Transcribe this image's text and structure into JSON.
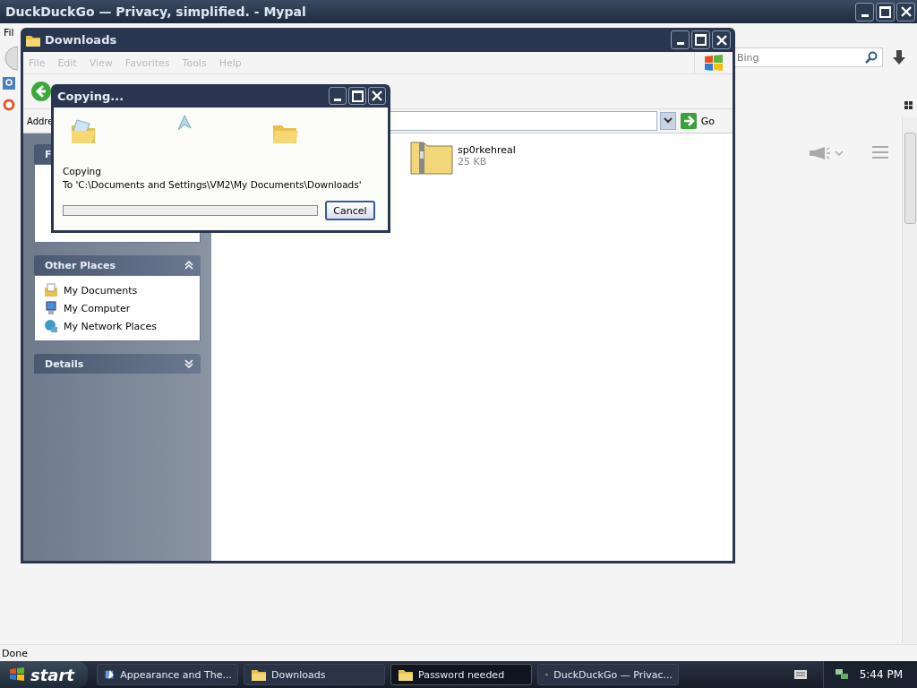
{
  "browser": {
    "title": "DuckDuckGo — Privacy, simplified. - Mypal",
    "menu_item": "Fil",
    "search": {
      "placeholder": "Bing"
    },
    "status": "Done"
  },
  "explorer": {
    "title": "Downloads",
    "menu": [
      "File",
      "Edit",
      "View",
      "Favorites",
      "Tools",
      "Help"
    ],
    "address_label": "Addre",
    "go": "Go",
    "panels": [
      {
        "title": "F"
      },
      {
        "title": "Other Places",
        "expanded": true,
        "items": [
          {
            "label": "My Documents",
            "kind": "documents"
          },
          {
            "label": "My Computer",
            "kind": "computer"
          },
          {
            "label": "My Network Places",
            "kind": "network"
          }
        ]
      },
      {
        "title": "Details",
        "expanded": false
      }
    ],
    "files": [
      {
        "name": "sp0rkehreal",
        "size": "25 KB"
      }
    ]
  },
  "dialog": {
    "title": "Copying...",
    "status": "Copying",
    "destination": "To 'C:\\Documents and Settings\\VM2\\My Documents\\Downloads'",
    "level": 0,
    "cancel": "Cancel"
  },
  "taskbar": {
    "start": "start",
    "tasks": [
      {
        "label": "Appearance and The...",
        "kind": "control",
        "selected": false
      },
      {
        "label": "Downloads",
        "kind": "folder",
        "selected": false
      },
      {
        "label": "Password needed",
        "kind": "folder",
        "selected": true
      },
      {
        "label": "DuckDuckGo — Privac...",
        "kind": "browser",
        "selected": false
      }
    ],
    "clock": "5:44 PM"
  }
}
